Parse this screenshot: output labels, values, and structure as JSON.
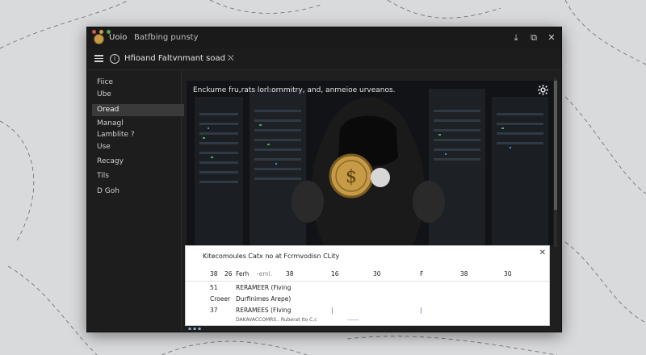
{
  "window": {
    "app_name": "Uoio",
    "title": "Batfbing punsty",
    "controls": [
      "⤓",
      "⧉",
      "✕"
    ]
  },
  "header": {
    "subtitle": "Hfioand Faltvnmant soad ⛌"
  },
  "sidebar": {
    "items": [
      {
        "label": "Fiice",
        "active": false
      },
      {
        "label": "Ube",
        "active": false
      },
      {
        "label": "Oread",
        "active": true
      },
      {
        "label": "Managl",
        "active": false
      },
      {
        "label": "Lamblite ?",
        "active": false
      },
      {
        "label": "Use",
        "active": false
      },
      {
        "label": "Recagy",
        "active": false
      },
      {
        "label": "Tils",
        "active": false
      },
      {
        "label": "D Goh",
        "active": false
      }
    ]
  },
  "main": {
    "caption": "Enckume fru,rats lorl:ornmitry, and, anmeioe urveanos.",
    "image_description_icon": "hooded-figure-coin-icon"
  },
  "panel": {
    "title": "Kitecomoules Catx no at Fcrmvodisn CLity",
    "close_glyph": "✕",
    "header_row": [
      "38",
      "26",
      "Ferh",
      "-eml.",
      "38",
      "16",
      "30",
      "F",
      "38",
      "30"
    ],
    "rows": [
      {
        "col1": "51",
        "col2": "RERAMEER (Fiving"
      },
      {
        "col1": "Croeer",
        "col2": "Durfinimes Arepe)"
      },
      {
        "col1": "37",
        "col2": "RERAMEES (Flving"
      }
    ],
    "footer_fragment": "DAKAVACCOMRS.. Ruberat Ito  C,c",
    "footer_fragment2": "-——"
  },
  "colors": {
    "window_bg": "#1f1f1f",
    "titlebar_bg": "#1a1a1a",
    "sidebar_active": "#3a3a3a",
    "coin_gold": "#c79a45",
    "panel_bg": "#ffffff"
  }
}
